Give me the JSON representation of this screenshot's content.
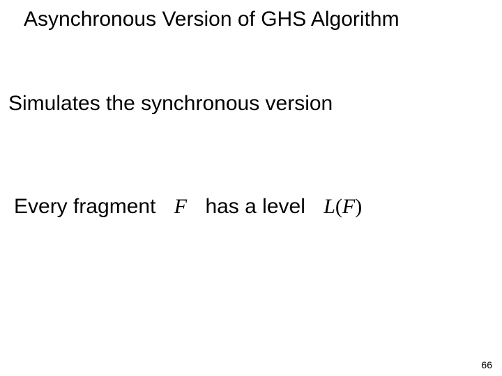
{
  "slide": {
    "title": "Asynchronous Version of GHS Algorithm",
    "line1": "Simulates the synchronous version",
    "line2": {
      "prefix": "Every fragment",
      "symbol1": "F",
      "middle": "has a level",
      "symbol2_func": "L",
      "symbol2_open": "(",
      "symbol2_arg": "F",
      "symbol2_close": ")"
    },
    "page_number": "66"
  }
}
